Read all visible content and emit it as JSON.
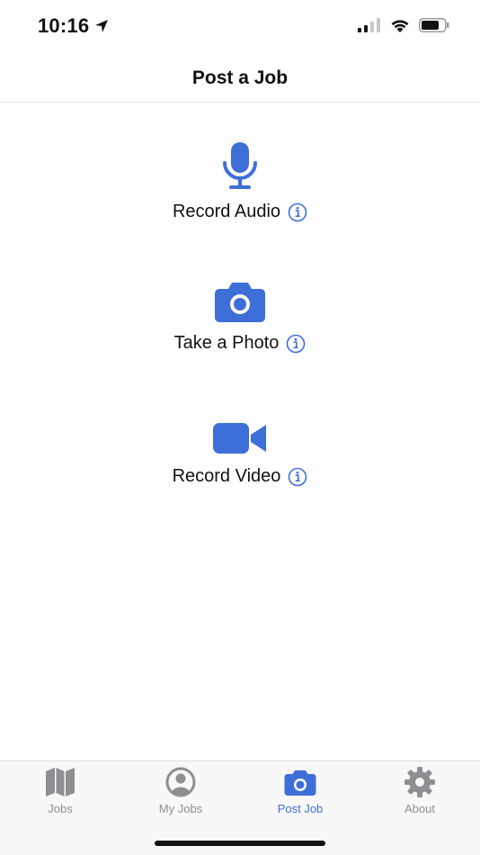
{
  "status_bar": {
    "time": "10:16"
  },
  "nav": {
    "title": "Post a Job"
  },
  "actions": [
    {
      "label": "Record Audio",
      "icon": "microphone-icon"
    },
    {
      "label": "Take a Photo",
      "icon": "camera-icon"
    },
    {
      "label": "Record Video",
      "icon": "video-camera-icon"
    }
  ],
  "tabs": [
    {
      "label": "Jobs",
      "icon": "map-icon"
    },
    {
      "label": "My Jobs",
      "icon": "user-circle-icon"
    },
    {
      "label": "Post Job",
      "icon": "camera-icon",
      "active": true
    },
    {
      "label": "About",
      "icon": "gear-icon"
    }
  ],
  "colors": {
    "accent": "#3e6fd8",
    "inactive": "#8e8e93"
  }
}
